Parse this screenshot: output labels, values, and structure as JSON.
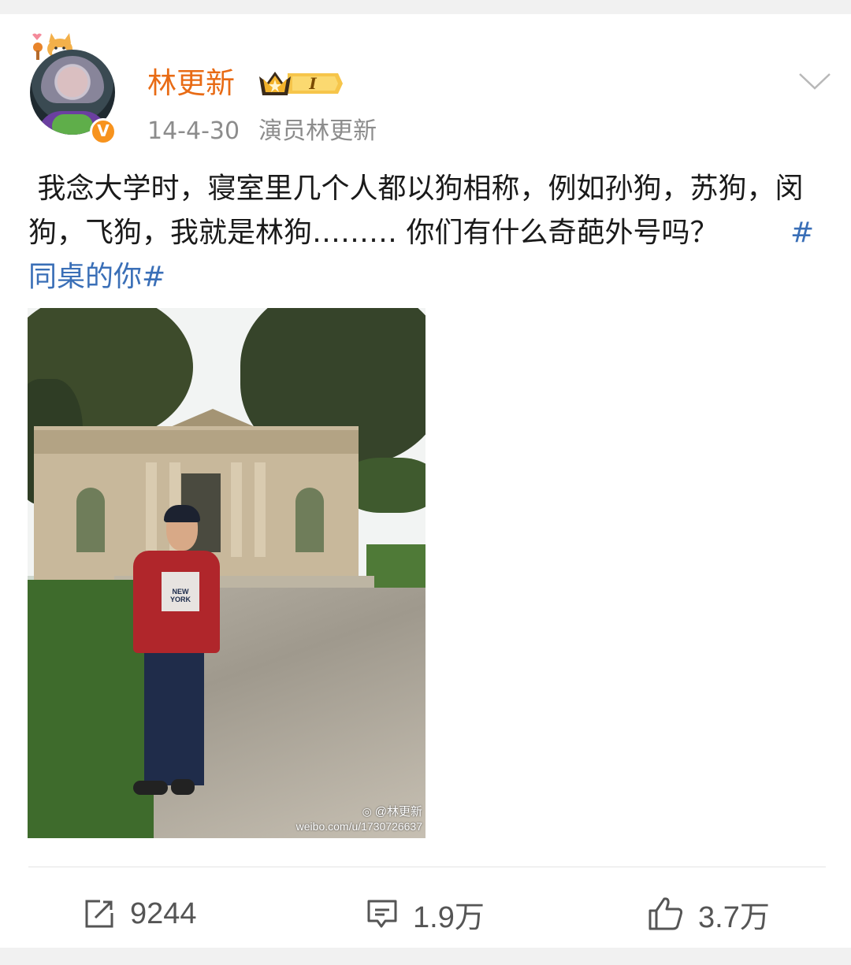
{
  "post": {
    "username": "林更新",
    "member_badge_text": "I",
    "date": "14-4-30",
    "source": "演员林更新",
    "text": " 我念大学时，寝室里几个人都以狗相称，例如孙狗，苏狗，闵狗，飞狗，我就是林狗……… 你们有什么奇葩外号吗？        ",
    "hashtag": "#同桌的你#",
    "image": {
      "shirt_text": "NEW YORK",
      "watermark_handle": "@林更新",
      "watermark_url": "weibo.com/u/1730726637"
    }
  },
  "actions": {
    "repost_count": "9244",
    "comment_count": "1.9万",
    "like_count": "3.7万"
  },
  "colors": {
    "username": "#e86b15",
    "hashtag": "#3a6fb7",
    "verified": "#f7931e"
  },
  "icons": [
    "chevron-down-icon",
    "repost-icon",
    "comment-icon",
    "like-icon",
    "verified-icon",
    "crown-icon",
    "weibo-logo-icon"
  ]
}
